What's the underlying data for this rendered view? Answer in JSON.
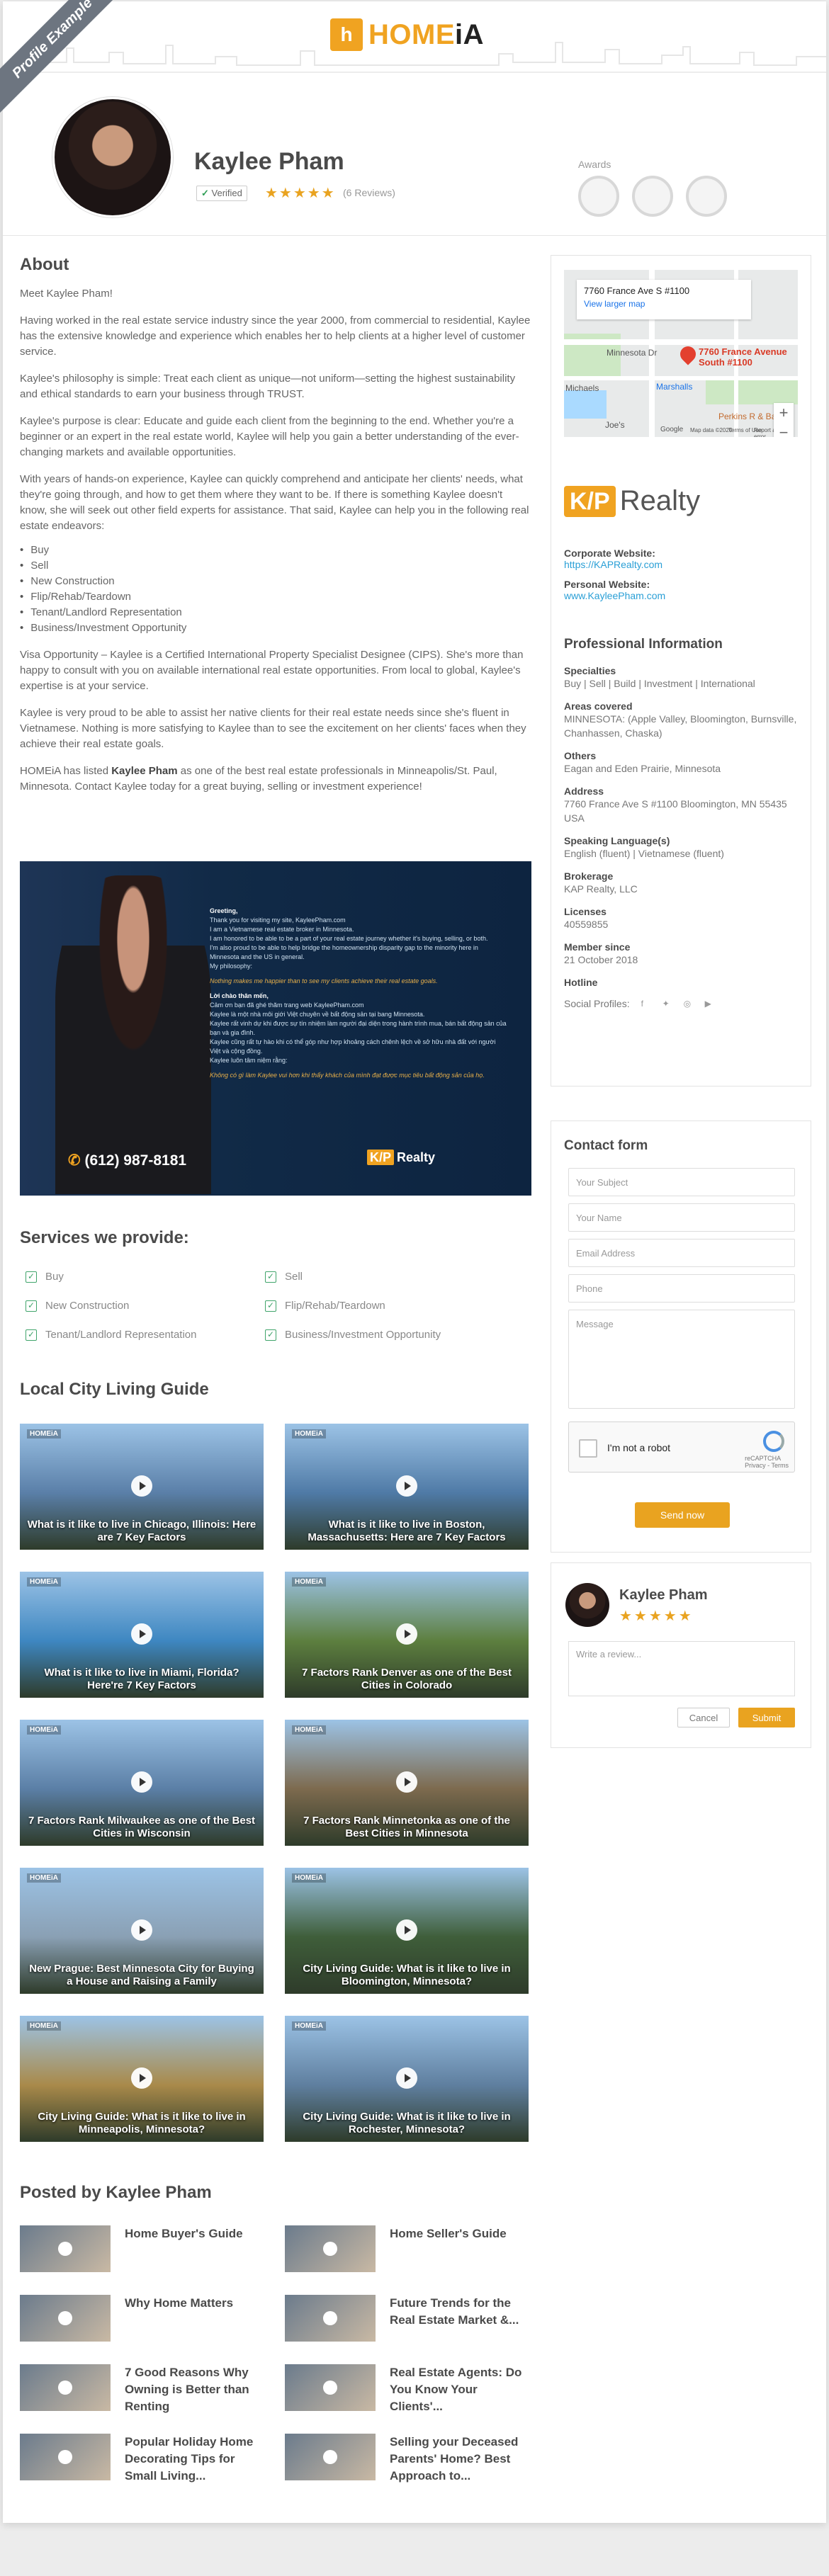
{
  "ribbon": "Profile Example",
  "brand": {
    "logo_main": "HOME",
    "logo_accent": "iA",
    "mark": "h"
  },
  "agent": {
    "name": "Kaylee Pham",
    "verified": "Verified",
    "stars": "★★★★★",
    "reviews": "(6 Reviews)",
    "awards_label": "Awards"
  },
  "about": {
    "title": "About",
    "paragraphs": [
      "Meet Kaylee Pham!",
      "Having worked in the real estate service industry since the year 2000, from commercial to residential, Kaylee has the extensive knowledge and experience which enables her to help clients at a higher level of customer service.",
      "Kaylee's philosophy is simple: Treat each client as unique—not uniform—setting the highest sustainability and ethical standards to earn your business through TRUST.",
      "Kaylee's purpose is clear: Educate and guide each client from the beginning to the end. Whether you're a beginner or an expert in the real estate world, Kaylee will help you gain a better understanding of the ever-changing markets and available opportunities.",
      "With years of hands-on experience, Kaylee can quickly comprehend and anticipate her clients' needs, what they're going through, and how to get them where they want to be. If there is something Kaylee doesn't know, she will seek out other field experts for assistance. That said, Kaylee can help you in the following real estate endeavors:"
    ],
    "list": [
      "Buy",
      "Sell",
      "New Construction",
      "Flip/Rehab/Teardown",
      "Tenant/Landlord Representation",
      "Business/Investment Opportunity"
    ],
    "paragraphs2": [
      "Visa Opportunity – Kaylee is a Certified International Property Specialist Designee (CIPS). She's more than happy to consult with you on available international real estate opportunities. From local to global, Kaylee's expertise is at your service.",
      "Kaylee is very proud to be able to assist her native clients for their real estate needs since she's fluent in Vietnamese. Nothing is more satisfying to Kaylee than to see the excitement on her clients' faces when they achieve their real estate goals."
    ],
    "last_pre": "HOMEiA has listed ",
    "last_bold": "Kaylee Pham",
    "last_post": " as one of the best real estate professionals in Minneapolis/St. Paul, Minnesota. Contact Kaylee today for a great buying, selling or investment experience!"
  },
  "banner": {
    "greeting": "Greeting,",
    "lines": [
      "Thank you for visiting my site, KayleePham.com",
      "I am a Vietnamese real estate broker in Minnesota.",
      "I am honored to be able to be a part of your real estate journey whether it's buying, selling, or both.",
      "I'm also proud to be able to help bridge the homeownership disparity gap to the minority here in Minnesota and the US in general.",
      "My philosophy:"
    ],
    "quote": "Nothing makes me happier than to see my clients achieve their real estate goals.",
    "vn_title": "Lời chào thân mến,",
    "vn_lines": [
      "Cảm ơn bạn đã ghé thăm trang web KayleePham.com",
      "Kaylee là một nhà môi giới Việt chuyên về bất động sản tại bang Minnesota.",
      "Kaylee rất vinh dự khi được sự tín nhiệm làm người đại diện trong hành trình mua, bán bất động sản của bạn và gia đình.",
      "Kaylee cũng rất tự hào khi có thể góp như hợp khoảng cách chênh lệch về sở hữu nhà đất với người Việt và cộng đồng.",
      "Kaylee luôn tâm niệm rằng:"
    ],
    "vn_quote": "Không có gì làm Kaylee vui hơn khi thấy khách của mình đạt được mục tiêu bất động sản của họ.",
    "phone": "(612) 987-8181",
    "brand": "KAP Realty"
  },
  "services": {
    "title": "Services we provide:",
    "items": [
      "Buy",
      "Sell",
      "New Construction",
      "Flip/Rehab/Teardown",
      "Tenant/Landlord Representation",
      "Business/Investment Opportunity"
    ]
  },
  "guide": {
    "title": "Local City Living Guide",
    "brand": "HOMEiA",
    "videos": [
      "What is it like to live in Chicago, Illinois: Here are 7 Key Factors",
      "What is it like to live in Boston, Massachusetts: Here are 7 Key Factors",
      "What is it like to live in Miami, Florida? Here're 7 Key Factors",
      "7 Factors Rank Denver as one of the Best Cities in Colorado",
      "7 Factors Rank Milwaukee as one of the Best Cities in Wisconsin",
      "7 Factors Rank Minnetonka as one of the Best Cities in Minnesota",
      "New Prague: Best Minnesota City for Buying a House and Raising a Family",
      "City Living Guide: What is it like to live in Bloomington, Minnesota?",
      "City Living Guide: What is it like to live in Minneapolis, Minnesota?",
      "City Living Guide: What is it like to live in Rochester, Minnesota?"
    ],
    "colors": [
      "#5a7fa8",
      "#4f7aa6",
      "#3e87c1",
      "#5d7f3f",
      "#5b7fa6",
      "#7d6a4e",
      "#8aa0b4",
      "#3f5e3a",
      "#a98a4a",
      "#5f7f9f"
    ]
  },
  "posted": {
    "title": "Posted by Kaylee Pham",
    "items": [
      "Home Buyer's Guide",
      "Home Seller's Guide",
      "Why Home Matters",
      "Future Trends for the Real Estate Market &...",
      "7 Good Reasons Why Owning is Better than Renting",
      "Real Estate Agents: Do You Know Your Clients'...",
      "Popular Holiday Home Decorating Tips for Small Living...",
      "Selling your Deceased Parents' Home? Best Approach to..."
    ]
  },
  "map": {
    "address": "7760 France Ave S #1100",
    "larger": "View larger map",
    "pin_label_1": "7760 France Avenue",
    "pin_label_2": "South #1100",
    "labels": [
      "Minnesota Dr",
      "Michaels",
      "Marshalls",
      "Joe's",
      "Perkins R & Bakery",
      "Google",
      "Map data ©2020",
      "Terms of Use",
      "Report a map error"
    ]
  },
  "company": {
    "logo_box": "K/P",
    "logo_text": "Realty",
    "corporate_label": "Corporate Website:",
    "corporate_url": "https://KAPRealty.com",
    "personal_label": "Personal Website:",
    "personal_url": "www.KayleePham.com"
  },
  "pro": {
    "title": "Professional Information",
    "rows": [
      {
        "label": "Specialties",
        "value": "Buy | Sell | Build | Investment | International"
      },
      {
        "label": "Areas covered",
        "value": "MINNESOTA: (Apple Valley, Bloomington, Burnsville, Chanhassen, Chaska)"
      },
      {
        "label": "Others",
        "value": "Eagan and Eden Prairie, Minnesota"
      },
      {
        "label": "Address",
        "value": "7760 France Ave S #1100 Bloomington, MN 55435 USA"
      },
      {
        "label": "Speaking Language(s)",
        "value": "English (fluent) | Vietnamese (fluent)"
      },
      {
        "label": "Brokerage",
        "value": "KAP Realty, LLC"
      },
      {
        "label": "Licenses",
        "value": "40559855"
      },
      {
        "label": "Member since",
        "value": "21 October 2018"
      },
      {
        "label": "Hotline",
        "value": ""
      }
    ],
    "social_label": "Social Profiles:"
  },
  "contact": {
    "title": "Contact form",
    "subject": "Your Subject",
    "name": "Your Name",
    "email": "Email Address",
    "phone": "Phone",
    "message": "Message",
    "captcha": "I'm not a robot",
    "captcha_brand": "reCAPTCHA",
    "captcha_terms": "Privacy - Terms",
    "send": "Send now"
  },
  "review": {
    "name": "Kaylee Pham",
    "stars": "★★★★★",
    "placeholder": "Write a review...",
    "cancel": "Cancel",
    "submit": "Submit"
  },
  "colors": {
    "accent": "#e9a320",
    "link": "#2a9fd6",
    "check": "#40a46b"
  }
}
